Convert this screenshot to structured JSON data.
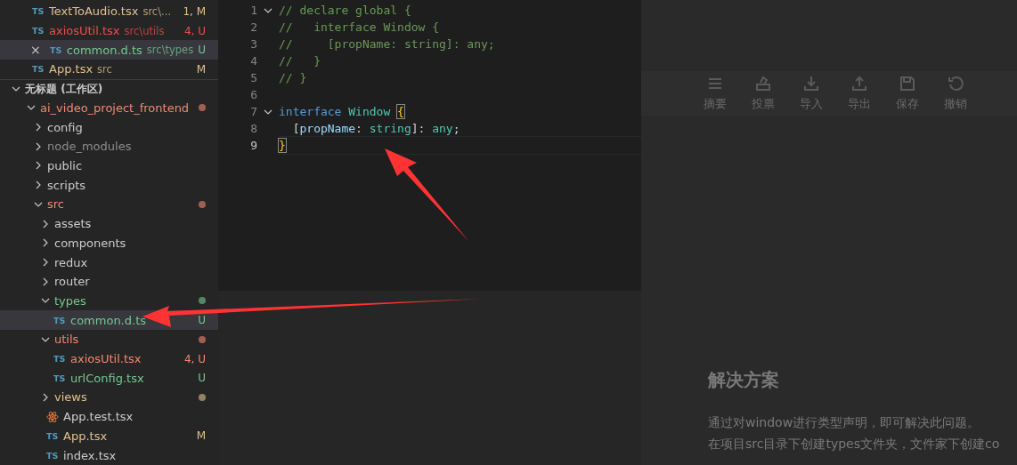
{
  "open_editors": [
    {
      "name": "TextToAudio.tsx",
      "icon": "TS",
      "path": "src\\...",
      "badge": "1, M",
      "color": "#e2c08d",
      "selected": false
    },
    {
      "name": "axiosUtil.tsx",
      "icon": "TS",
      "path": "src\\utils",
      "badge": "4, U",
      "color": "#f14c4c",
      "selected": false
    },
    {
      "name": "common.d.ts",
      "icon": "TS",
      "close": "×",
      "path": "src\\types",
      "badge": "U",
      "color": "#73c991",
      "selected": true
    },
    {
      "name": "App.tsx",
      "icon": "TS",
      "path": "src",
      "badge": "M",
      "color": "#e2c08d",
      "selected": false
    }
  ],
  "workspace": {
    "title": "无标题 (工作区)",
    "expanded": true
  },
  "tree": [
    {
      "name": "ai_video_project_frontend",
      "kind": "folder",
      "expanded": true,
      "color": "#f48771",
      "dot": true,
      "children": [
        {
          "name": "config",
          "kind": "folder",
          "expanded": false,
          "color": "#cccccc"
        },
        {
          "name": "node_modules",
          "kind": "folder",
          "expanded": false,
          "color": "#8c8c8c"
        },
        {
          "name": "public",
          "kind": "folder",
          "expanded": false,
          "color": "#cccccc"
        },
        {
          "name": "scripts",
          "kind": "folder",
          "expanded": false,
          "color": "#cccccc"
        },
        {
          "name": "src",
          "kind": "folder",
          "expanded": true,
          "color": "#f48771",
          "dot": true,
          "children": [
            {
              "name": "assets",
              "kind": "folder",
              "expanded": false,
              "color": "#cccccc"
            },
            {
              "name": "components",
              "kind": "folder",
              "expanded": false,
              "color": "#cccccc"
            },
            {
              "name": "redux",
              "kind": "folder",
              "expanded": false,
              "color": "#cccccc"
            },
            {
              "name": "router",
              "kind": "folder",
              "expanded": false,
              "color": "#cccccc"
            },
            {
              "name": "types",
              "kind": "folder",
              "expanded": true,
              "color": "#73c991",
              "dot": true,
              "children": [
                {
                  "name": "common.d.ts",
                  "kind": "ts",
                  "icon": "TS",
                  "color": "#73c991",
                  "badge": "U",
                  "selected": true
                }
              ]
            },
            {
              "name": "utils",
              "kind": "folder",
              "expanded": true,
              "color": "#f48771",
              "dot": true,
              "children": [
                {
                  "name": "axiosUtil.tsx",
                  "kind": "ts",
                  "icon": "TS",
                  "color": "#f48771",
                  "badge": "4, U",
                  "selected": false
                },
                {
                  "name": "urlConfig.tsx",
                  "kind": "ts",
                  "icon": "TS",
                  "color": "#73c991",
                  "badge": "U",
                  "selected": false
                }
              ]
            },
            {
              "name": "views",
              "kind": "folder",
              "expanded": false,
              "color": "#e2c08d",
              "dot": true
            },
            {
              "name": "App.test.tsx",
              "kind": "react",
              "color": "#cccccc",
              "selected": false
            },
            {
              "name": "App.tsx",
              "kind": "ts",
              "icon": "TS",
              "color": "#e2c08d",
              "badge": "M",
              "selected": false
            },
            {
              "name": "index.tsx",
              "kind": "ts",
              "icon": "TS",
              "color": "#cccccc",
              "selected": false
            }
          ]
        }
      ]
    }
  ],
  "editor": {
    "lines": [
      {
        "number": "1",
        "fold": true,
        "tokens": [
          {
            "text": "// declare global {",
            "kind": "comment"
          }
        ]
      },
      {
        "number": "2",
        "fold": false,
        "tokens": [
          {
            "text": "//   interface Window {",
            "kind": "comment"
          }
        ]
      },
      {
        "number": "3",
        "fold": false,
        "tokens": [
          {
            "text": "//     [propName: string]: any;",
            "kind": "comment"
          }
        ]
      },
      {
        "number": "4",
        "fold": false,
        "tokens": [
          {
            "text": "//   }",
            "kind": "comment"
          }
        ]
      },
      {
        "number": "5",
        "fold": false,
        "tokens": [
          {
            "text": "// }",
            "kind": "comment"
          }
        ]
      },
      {
        "number": "6",
        "fold": false
      },
      {
        "number": "7",
        "fold": true,
        "tokens": [
          {
            "text": "interface ",
            "kind": "keyword"
          },
          {
            "text": "Window ",
            "kind": "type"
          },
          {
            "text": "{",
            "kind": "bracket"
          }
        ]
      },
      {
        "number": "8",
        "fold": false,
        "tokens": [
          {
            "text": "  [",
            "kind": "plain"
          },
          {
            "text": "propName",
            "kind": "prop"
          },
          {
            "text": ": ",
            "kind": "plain"
          },
          {
            "text": "string",
            "kind": "type"
          },
          {
            "text": "]: ",
            "kind": "plain"
          },
          {
            "text": "any",
            "kind": "type"
          },
          {
            "text": ";",
            "kind": "plain"
          }
        ]
      },
      {
        "number": "9",
        "fold": false,
        "current": true,
        "tokens": [
          {
            "text": "}",
            "kind": "bracket"
          }
        ]
      }
    ]
  },
  "backdrop": {
    "toolbar": [
      {
        "label": "摘要",
        "kind": "summary"
      },
      {
        "label": "投票",
        "kind": "vote"
      },
      {
        "label": "导入",
        "kind": "import"
      },
      {
        "label": "导出",
        "kind": "export"
      },
      {
        "label": "保存",
        "kind": "save"
      },
      {
        "label": "撤销",
        "kind": "undo"
      }
    ],
    "heading": "解决方案",
    "paragraphs": [
      "通过对window进行类型声明，即可解决此问题。",
      "在项目src目录下创建types文件夹，文件家下创建co"
    ]
  }
}
